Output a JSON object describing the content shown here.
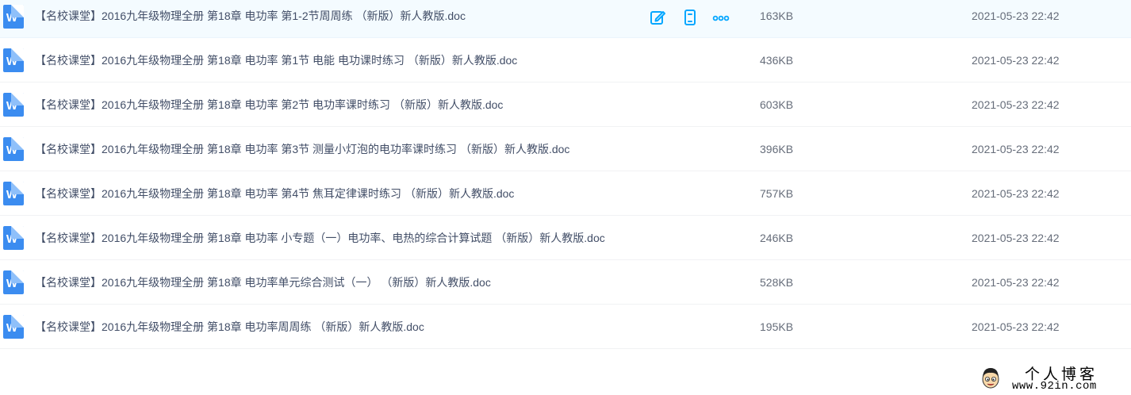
{
  "files": [
    {
      "name": "【名校课堂】2016九年级物理全册 第18章 电功率 第1-2节周周练 （新版）新人教版.doc",
      "size": "163KB",
      "time": "2021-05-23 22:42",
      "icon": "W"
    },
    {
      "name": "【名校课堂】2016九年级物理全册 第18章 电功率 第1节 电能 电功课时练习 （新版）新人教版.doc",
      "size": "436KB",
      "time": "2021-05-23 22:42",
      "icon": "W"
    },
    {
      "name": "【名校课堂】2016九年级物理全册 第18章 电功率 第2节 电功率课时练习 （新版）新人教版.doc",
      "size": "603KB",
      "time": "2021-05-23 22:42",
      "icon": "W"
    },
    {
      "name": "【名校课堂】2016九年级物理全册 第18章 电功率 第3节 测量小灯泡的电功率课时练习 （新版）新人教版.doc",
      "size": "396KB",
      "time": "2021-05-23 22:42",
      "icon": "W"
    },
    {
      "name": "【名校课堂】2016九年级物理全册 第18章 电功率 第4节 焦耳定律课时练习 （新版）新人教版.doc",
      "size": "757KB",
      "time": "2021-05-23 22:42",
      "icon": "W"
    },
    {
      "name": "【名校课堂】2016九年级物理全册 第18章 电功率 小专题（一）电功率、电热的综合计算试题 （新版）新人教版.doc",
      "size": "246KB",
      "time": "2021-05-23 22:42",
      "icon": "W"
    },
    {
      "name": "【名校课堂】2016九年级物理全册 第18章 电功率单元综合测试（一） （新版）新人教版.doc",
      "size": "528KB",
      "time": "2021-05-23 22:42",
      "icon": "W"
    },
    {
      "name": "【名校课堂】2016九年级物理全册 第18章 电功率周周练 （新版）新人教版.doc",
      "size": "195KB",
      "time": "2021-05-23 22:42",
      "icon": "W"
    }
  ],
  "row_actions": {
    "edit_icon": "edit-icon",
    "phone_icon": "send-to-phone-icon",
    "more_icon": "more-icon",
    "accent_color": "#06a7ff"
  },
  "watermark": {
    "title": "个人博客",
    "url": "www.92in.com"
  },
  "colors": {
    "hover_row": "#f4fbff",
    "doc_icon": "#3b8cf0",
    "text": "#424e67"
  }
}
